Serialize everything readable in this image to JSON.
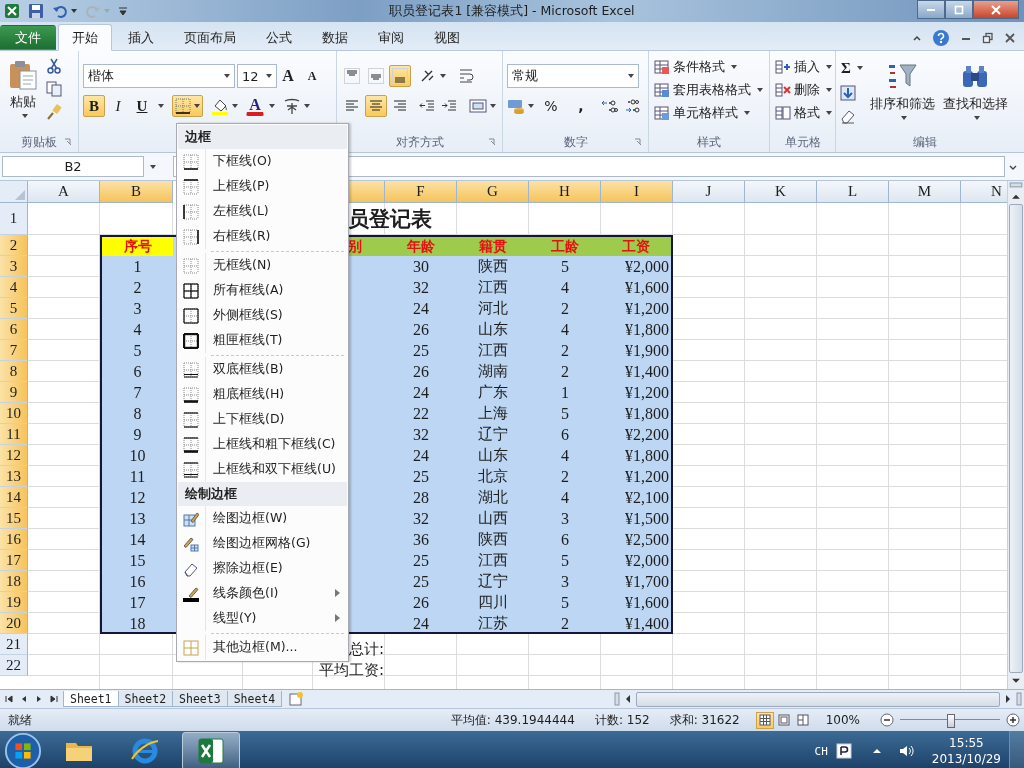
{
  "window": {
    "title": "职员登记表1  [兼容模式]  -  Microsoft Excel"
  },
  "file_tab": {
    "label": "文件"
  },
  "tabs": [
    {
      "label": "开始",
      "selected": true
    },
    {
      "label": "插入",
      "selected": false
    },
    {
      "label": "页面布局",
      "selected": false
    },
    {
      "label": "公式",
      "selected": false
    },
    {
      "label": "数据",
      "selected": false
    },
    {
      "label": "审阅",
      "selected": false
    },
    {
      "label": "视图",
      "selected": false
    }
  ],
  "ribbon": {
    "clipboard": {
      "paste": "粘贴",
      "label": "剪贴板"
    },
    "font": {
      "family": "楷体",
      "size": "12",
      "grow": "A",
      "shrink": "A",
      "bold": {
        "label": "B",
        "on": true
      },
      "italic": {
        "label": "I",
        "on": false
      },
      "underline": {
        "label": "U",
        "on": false
      },
      "border_button": {
        "on": true
      },
      "font_color": "A"
    },
    "alignment": {
      "label": "对齐方式",
      "vertical": [
        {
          "kind": "top",
          "selected": false
        },
        {
          "kind": "middle",
          "selected": false
        },
        {
          "kind": "bottom",
          "selected": true
        }
      ],
      "horizontal": [
        {
          "kind": "left",
          "selected": false
        },
        {
          "kind": "center",
          "selected": true
        },
        {
          "kind": "right",
          "selected": false
        }
      ]
    },
    "number": {
      "format": "常规",
      "percent": "%",
      "comma": ",",
      "label": "数字"
    },
    "styles": {
      "items": [
        "条件格式",
        "套用表格格式",
        "单元格样式"
      ],
      "label": "样式"
    },
    "cells": {
      "items": [
        "插入",
        "删除",
        "格式"
      ],
      "label": "单元格"
    },
    "editing": {
      "sum": "Σ",
      "sort": "排序和筛选",
      "find": "查找和选择",
      "label": "编辑"
    }
  },
  "name_box": {
    "value": "B2"
  },
  "sheet": {
    "columns_left": [
      {
        "label": "A",
        "selected": false
      },
      {
        "label": "B",
        "selected": true
      }
    ],
    "columns_right": [
      {
        "selected": true
      },
      {
        "label": "F",
        "selected": true
      },
      {
        "label": "G",
        "selected": true
      },
      {
        "label": "H",
        "selected": true
      },
      {
        "label": "I",
        "selected": true
      },
      {
        "label": "J",
        "selected": false
      },
      {
        "label": "K",
        "selected": false
      },
      {
        "label": "L",
        "selected": false
      },
      {
        "label": "M",
        "selected": false
      },
      {
        "label": "N",
        "selected": false
      }
    ],
    "rows": [
      {
        "label": "1",
        "selected": false
      },
      {
        "label": "2",
        "selected": true
      },
      {
        "label": "3",
        "selected": true
      },
      {
        "label": "4",
        "selected": true
      },
      {
        "label": "5",
        "selected": true
      },
      {
        "label": "6",
        "selected": true
      },
      {
        "label": "7",
        "selected": true
      },
      {
        "label": "8",
        "selected": true
      },
      {
        "label": "9",
        "selected": true
      },
      {
        "label": "10",
        "selected": true
      },
      {
        "label": "11",
        "selected": true
      },
      {
        "label": "12",
        "selected": true
      },
      {
        "label": "13",
        "selected": true
      },
      {
        "label": "14",
        "selected": true
      },
      {
        "label": "15",
        "selected": true
      },
      {
        "label": "16",
        "selected": true
      },
      {
        "label": "17",
        "selected": true
      },
      {
        "label": "18",
        "selected": true
      },
      {
        "label": "19",
        "selected": true
      },
      {
        "label": "20",
        "selected": true
      },
      {
        "label": "21",
        "selected": false
      },
      {
        "label": "22",
        "selected": false
      }
    ],
    "title": "员登记表",
    "header_row": [
      "序号",
      "别",
      "年龄",
      "籍贯",
      "工龄",
      "工资"
    ],
    "records": [
      [
        "1",
        "30",
        "陕西",
        "5",
        "¥2,000"
      ],
      [
        "2",
        "32",
        "江西",
        "4",
        "¥1,600"
      ],
      [
        "3",
        "24",
        "河北",
        "2",
        "¥1,200"
      ],
      [
        "4",
        "26",
        "山东",
        "4",
        "¥1,800"
      ],
      [
        "5",
        "25",
        "江西",
        "2",
        "¥1,900"
      ],
      [
        "6",
        "26",
        "湖南",
        "2",
        "¥1,400"
      ],
      [
        "7",
        "24",
        "广东",
        "1",
        "¥1,200"
      ],
      [
        "8",
        "22",
        "上海",
        "5",
        "¥1,800"
      ],
      [
        "9",
        "32",
        "辽宁",
        "6",
        "¥2,200"
      ],
      [
        "10",
        "24",
        "山东",
        "4",
        "¥1,800"
      ],
      [
        "11",
        "25",
        "北京",
        "2",
        "¥1,200"
      ],
      [
        "12",
        "28",
        "湖北",
        "4",
        "¥2,100"
      ],
      [
        "13",
        "32",
        "山西",
        "3",
        "¥1,500"
      ],
      [
        "14",
        "36",
        "陕西",
        "6",
        "¥2,500"
      ],
      [
        "15",
        "25",
        "江西",
        "5",
        "¥2,000"
      ],
      [
        "16",
        "25",
        "辽宁",
        "3",
        "¥1,700"
      ],
      [
        "17",
        "26",
        "四川",
        "5",
        "¥1,600"
      ],
      [
        "18",
        "24",
        "江苏",
        "2",
        "¥1,400"
      ]
    ],
    "total_label": "总计:",
    "average_label": "平均工资:"
  },
  "border_menu": {
    "sections": [
      {
        "title": "边框",
        "groups": [
          [
            {
              "label": "下框线(O)",
              "kind": "bottom",
              "submenu": false
            },
            {
              "label": "上框线(P)",
              "kind": "top",
              "submenu": false
            },
            {
              "label": "左框线(L)",
              "kind": "left",
              "submenu": false
            },
            {
              "label": "右框线(R)",
              "kind": "right",
              "submenu": false
            }
          ],
          [
            {
              "label": "无框线(N)",
              "kind": "none",
              "submenu": false
            },
            {
              "label": "所有框线(A)",
              "kind": "all",
              "submenu": false
            },
            {
              "label": "外侧框线(S)",
              "kind": "outside",
              "submenu": false
            },
            {
              "label": "粗匣框线(T)",
              "kind": "thick",
              "submenu": false
            }
          ],
          [
            {
              "label": "双底框线(B)",
              "kind": "double_bottom",
              "submenu": false
            },
            {
              "label": "粗底框线(H)",
              "kind": "thick_bottom",
              "submenu": false
            },
            {
              "label": "上下框线(D)",
              "kind": "top_bottom",
              "submenu": false
            },
            {
              "label": "上框线和粗下框线(C)",
              "kind": "top_thick_bottom",
              "submenu": false
            },
            {
              "label": "上框线和双下框线(U)",
              "kind": "top_double_bottom",
              "submenu": false
            }
          ]
        ]
      },
      {
        "title": "绘制边框",
        "groups": [
          [
            {
              "label": "绘图边框(W)",
              "kind": "draw",
              "submenu": false
            },
            {
              "label": "绘图边框网格(G)",
              "kind": "draw_grid",
              "submenu": false
            },
            {
              "label": "擦除边框(E)",
              "kind": "erase",
              "submenu": false
            },
            {
              "label": "线条颜色(I)",
              "kind": "line_color",
              "submenu": true
            },
            {
              "label": "线型(Y)",
              "kind": "line_style",
              "submenu": true
            }
          ],
          [
            {
              "label": "其他边框(M)...",
              "kind": "more",
              "submenu": false
            }
          ]
        ]
      }
    ]
  },
  "sheet_tabs": [
    {
      "label": "Sheet1",
      "selected": true
    },
    {
      "label": "Sheet2",
      "selected": false
    },
    {
      "label": "Sheet3",
      "selected": false
    },
    {
      "label": "Sheet4",
      "selected": false
    }
  ],
  "status_bar": {
    "ready": "就绪",
    "average": "平均值: 439.1944444",
    "count": "计数: 152",
    "sum": "求和: 31622",
    "views": [
      {
        "kind": "normal",
        "selected": true
      },
      {
        "kind": "layout",
        "selected": false
      },
      {
        "kind": "break",
        "selected": false
      }
    ],
    "zoom": "100%",
    "zoom_slider": {
      "level": 0.5
    }
  },
  "taskbar": {
    "apps": [
      {
        "kind": "explorer",
        "selected": false
      },
      {
        "kind": "browser",
        "selected": false
      },
      {
        "kind": "excel",
        "selected": true
      }
    ],
    "language": "CH",
    "time": "15:55",
    "date": "2013/10/29"
  }
}
